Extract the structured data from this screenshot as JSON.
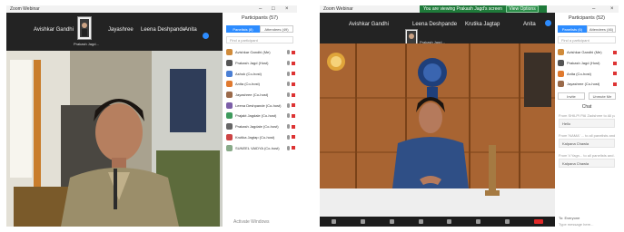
{
  "window1": {
    "title": "Zoom Webinar",
    "strip": {
      "tiles": [
        "Avishkar Gandhi",
        "Jayashree",
        "Leena Deshpande",
        "Anita"
      ],
      "active_speaker": "Prakash Jagd..."
    },
    "participants_panel": {
      "title": "Participants (57)",
      "tabs": [
        "Panelists (8)",
        "Attendees (49)"
      ],
      "search_placeholder": "Find a participant",
      "rows": [
        "Avishkar Gandhi (Me)",
        "Prakash Jagd (Host)",
        "Ashok (Co-host)",
        "Anita (Co-host)",
        "Jayashree (Co-host)",
        "Leena Deshpande (Co-host)",
        "Prajakt Jagdale (Co-host)",
        "Prakash Jagdale (Co-host)",
        "Krutika Jagtap (Co-host)",
        "SUNEEL VAIDYA (Co-host)"
      ]
    },
    "watermark": "Activate Windows"
  },
  "window2": {
    "title": "Zoom Webinar",
    "banner": {
      "text": "You are viewing Prakash Jagd's screen",
      "button": "View Options"
    },
    "strip": {
      "tiles": [
        "Avishkar Gandhi",
        "Leena Deshpande",
        "Krutika Jagtap",
        "Anita"
      ],
      "active_speaker": "Prakash Jagd..."
    },
    "participants_panel": {
      "title": "Participants (52)",
      "tabs": [
        "Panelists (6)",
        "Attendees (46)"
      ],
      "search_placeholder": "Find a participant",
      "rows": [
        "Avishkar Gandhi (Me)",
        "Prakash Jagd (Host)",
        "Anita (Co-host)",
        "Jayashree (Co-host)"
      ],
      "buttons": [
        "Invite",
        "Unmute Me"
      ]
    },
    "chat": {
      "title": "Chat",
      "messages": [
        {
          "meta": "From SHILPI PAI Zadshree to All panelists...",
          "text": "Hello"
        },
        {
          "meta": "From 'NAMA' ... to all panelists and attendees",
          "text": "Kalpana Chawla"
        },
        {
          "meta": "From V.Yagn... to all panelists and attendees",
          "text": "Kalpana Chawla"
        }
      ],
      "to_label": "To: Everyone",
      "input_placeholder": "Type message here..."
    }
  },
  "colors": {
    "zoom_blue": "#2d8cff",
    "dark_bg": "#1e1e1e",
    "banner_green": "#1f7a3a",
    "leave_red": "#e02828"
  }
}
